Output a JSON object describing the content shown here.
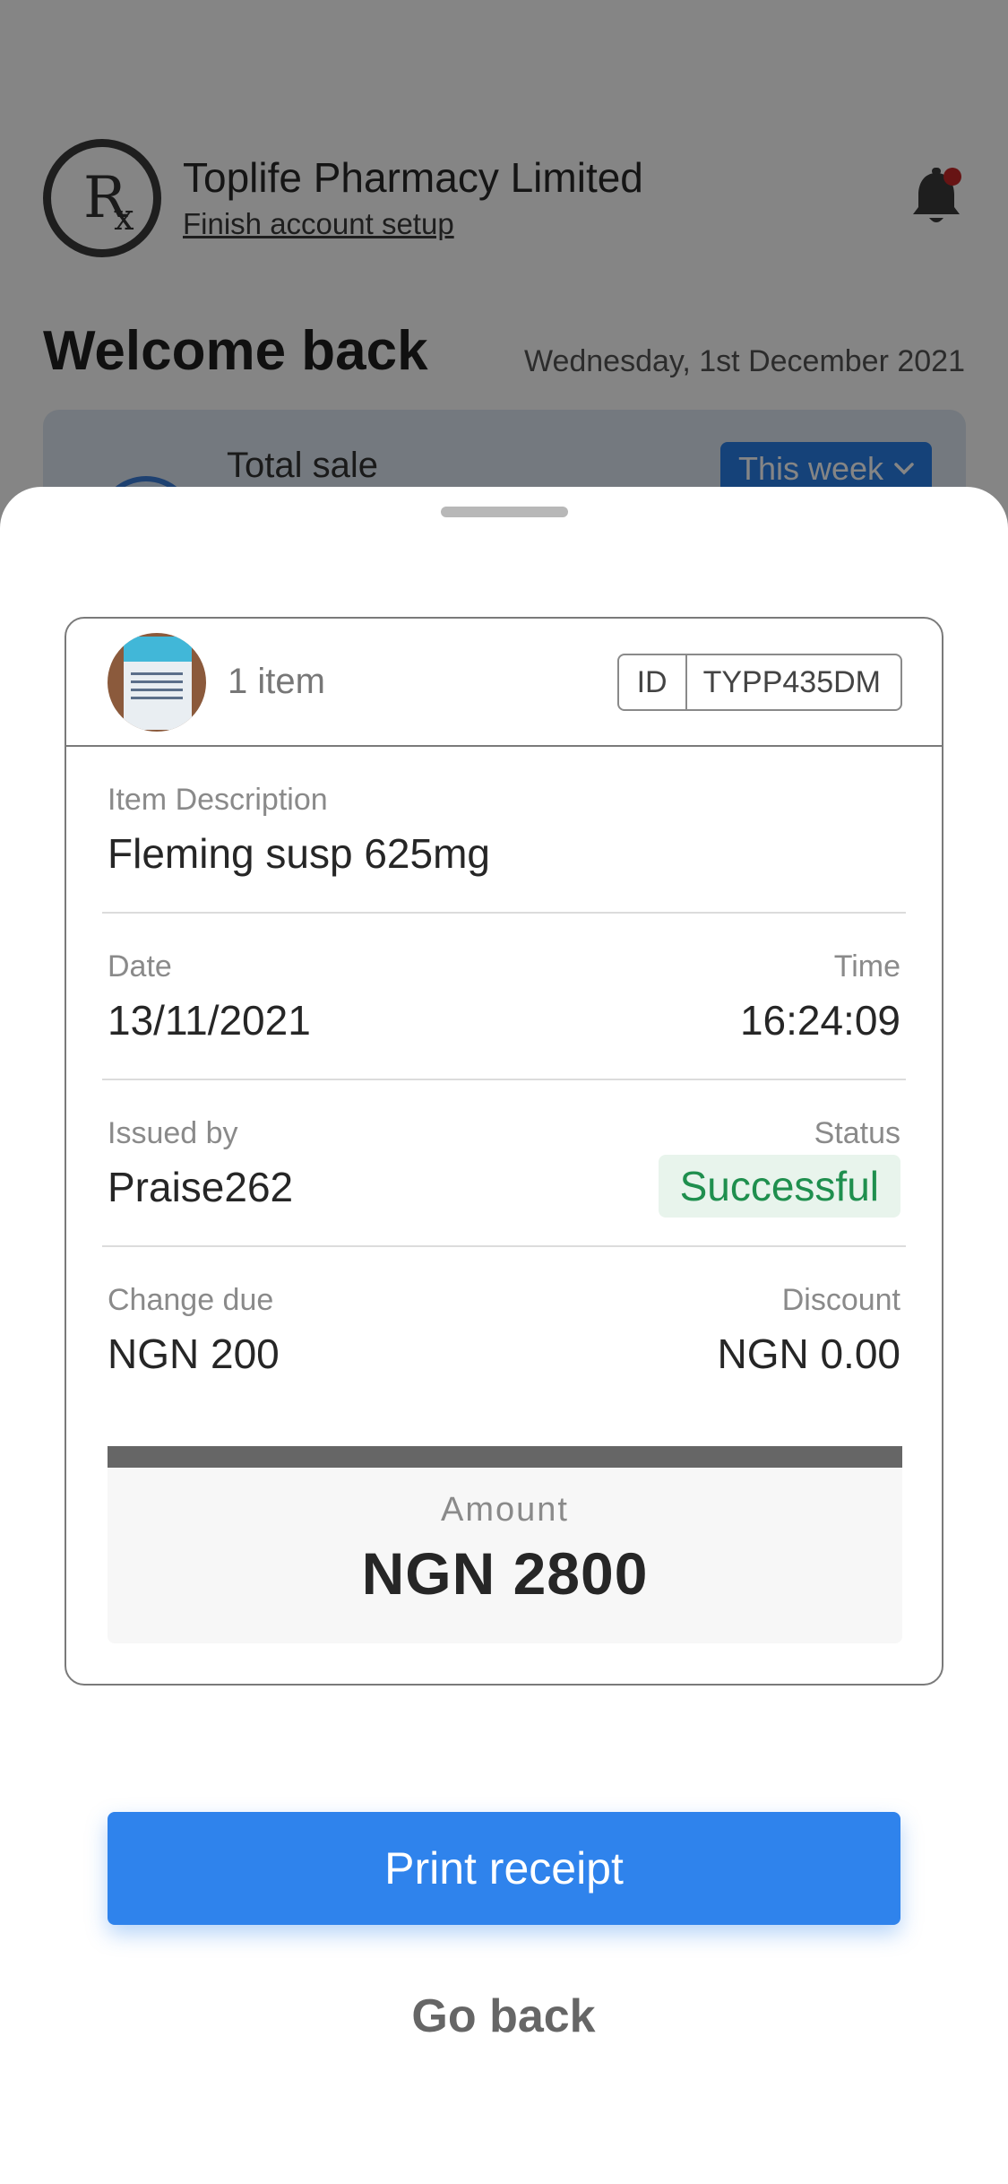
{
  "background": {
    "org_name": "Toplife Pharmacy Limited",
    "setup_link": "Finish account setup",
    "welcome": "Welcome back",
    "date": "Wednesday, 1st December 2021",
    "stats": {
      "total_sale_label": "Total sale",
      "period_button": "This week"
    },
    "icons": {
      "logo": "rx-logo",
      "bell": "notification-bell-icon",
      "dropdown": "chevron-down-icon"
    }
  },
  "receipt": {
    "item_count": "1 item",
    "id_label": "ID",
    "id_value": "TYPP435DM",
    "item_description_label": "Item Description",
    "item_description": "Fleming susp 625mg",
    "date_label": "Date",
    "date": "13/11/2021",
    "time_label": "Time",
    "time": "16:24:09",
    "issued_by_label": "Issued by",
    "issued_by": "Praise262",
    "status_label": "Status",
    "status": "Successful",
    "change_due_label": "Change due",
    "change_due": "NGN 200",
    "discount_label": "Discount",
    "discount": "NGN 0.00",
    "amount_label": "Amount",
    "amount": "NGN 2800"
  },
  "actions": {
    "print": "Print receipt",
    "back": "Go back"
  },
  "colors": {
    "primary": "#2f83ec",
    "success": "#1f8f4e",
    "success_bg": "#e8f4ec",
    "scrim": "rgba(0,0,0,0.48)"
  }
}
